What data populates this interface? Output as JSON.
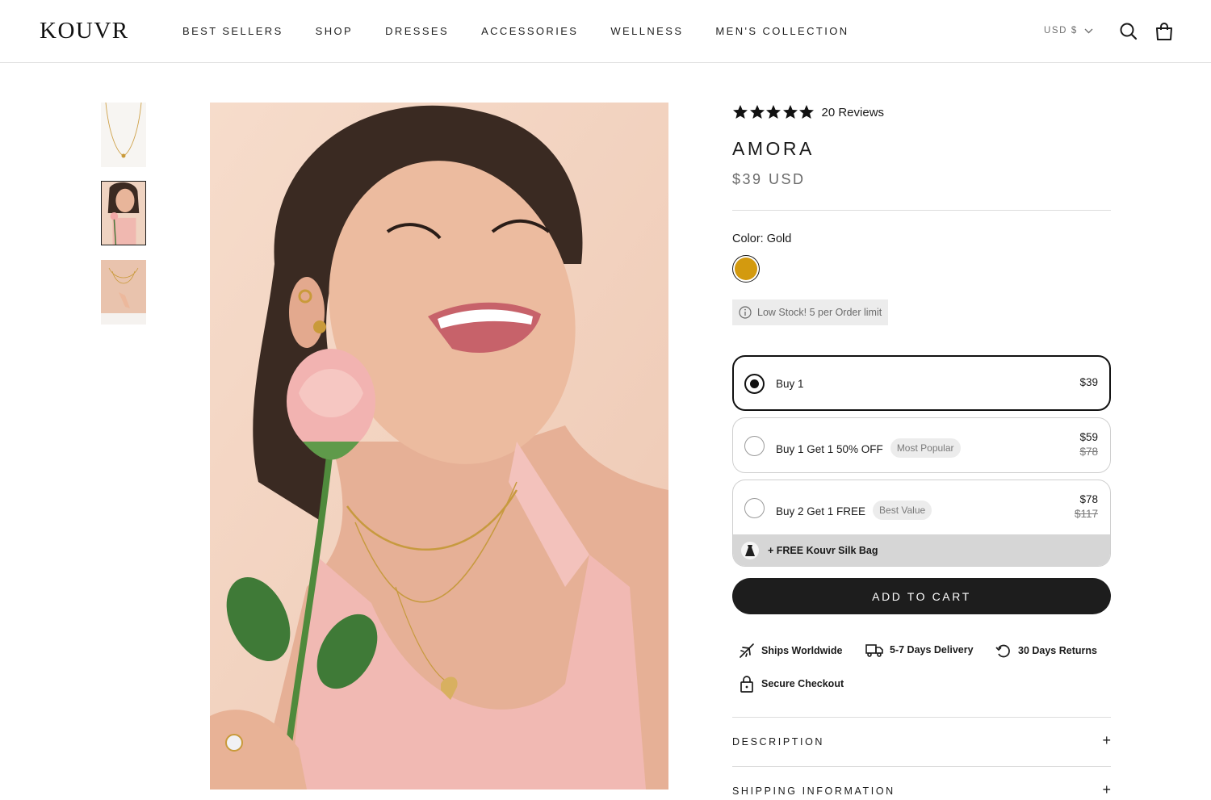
{
  "brand": {
    "logo": "KOUVR"
  },
  "nav": {
    "items": [
      "BEST SELLERS",
      "SHOP",
      "DRESSES",
      "ACCESSORIES",
      "WELLNESS",
      "MEN'S COLLECTION"
    ]
  },
  "header": {
    "currency": "USD $",
    "search_icon": "search-icon",
    "cart_icon": "bag-icon"
  },
  "product": {
    "rating_stars": 5,
    "reviews": "20 Reviews",
    "title": "AMORA",
    "price": "$39 USD",
    "color_label": "Color: Gold",
    "color_swatch": "#d39a0f",
    "stock_notice": "Low Stock! 5 per Order limit"
  },
  "offers": [
    {
      "label": "Buy 1",
      "badge": "",
      "price": "$39",
      "old_price": "",
      "selected": true
    },
    {
      "label": "Buy 1 Get 1 50% OFF",
      "badge": "Most Popular",
      "price": "$59",
      "old_price": "$78",
      "selected": false
    },
    {
      "label": "Buy 2 Get 1 FREE",
      "badge": "Best Value",
      "price": "$78",
      "old_price": "$117",
      "selected": false,
      "gift": "+ FREE Kouvr Silk Bag"
    }
  ],
  "cta": {
    "add_to_cart": "ADD TO CART"
  },
  "perks": [
    "Ships Worldwide",
    "5-7 Days Delivery",
    "30 Days Returns",
    "Secure Checkout"
  ],
  "accordions": [
    "DESCRIPTION",
    "SHIPPING INFORMATION"
  ],
  "colors": {
    "accent": "#1d1d1d",
    "gold": "#d39a0f",
    "muted": "#6b6b6b"
  }
}
